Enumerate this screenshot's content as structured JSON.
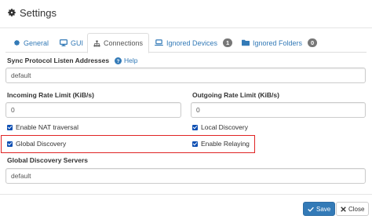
{
  "dialog": {
    "title": "Settings"
  },
  "tabs": [
    {
      "label": "General",
      "icon": "gear-icon"
    },
    {
      "label": "GUI",
      "icon": "monitor-icon"
    },
    {
      "label": "Connections",
      "icon": "sitemap-icon",
      "active": true
    },
    {
      "label": "Ignored Devices",
      "icon": "laptop-icon",
      "badge": "1"
    },
    {
      "label": "Ignored Folders",
      "icon": "folder-icon",
      "badge": "0"
    }
  ],
  "fields": {
    "listen_addresses_label": "Sync Protocol Listen Addresses",
    "help_label": "Help",
    "listen_addresses_value": "default",
    "incoming_rate_label": "Incoming Rate Limit (KiB/s)",
    "incoming_rate_value": "0",
    "outgoing_rate_label": "Outgoing Rate Limit (KiB/s)",
    "outgoing_rate_value": "0",
    "global_discovery_servers_label": "Global Discovery Servers",
    "global_discovery_servers_value": "default"
  },
  "checkboxes": {
    "nat_traversal": {
      "label": "Enable NAT traversal",
      "checked": true
    },
    "local_discovery": {
      "label": "Local Discovery",
      "checked": true
    },
    "global_discovery": {
      "label": "Global Discovery",
      "checked": true
    },
    "relaying": {
      "label": "Enable Relaying",
      "checked": true
    }
  },
  "footer": {
    "save_label": "Save",
    "close_label": "Close"
  },
  "colors": {
    "accent": "#337ab7",
    "checkbox": "#0d4fb3",
    "highlight": "#e02424",
    "badge": "#777777"
  }
}
